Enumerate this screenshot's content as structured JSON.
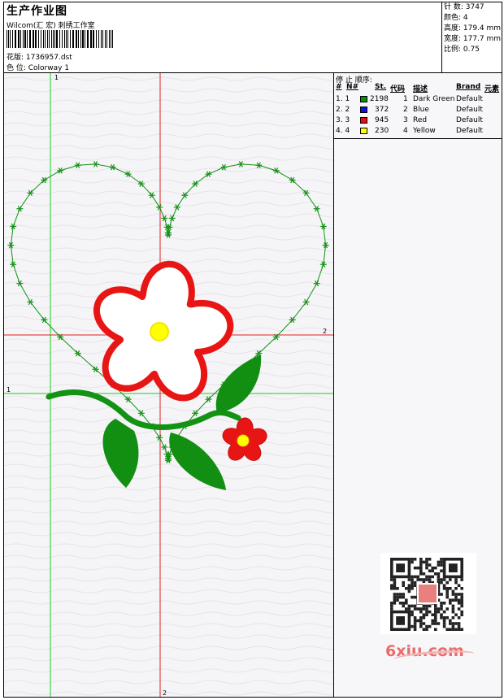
{
  "header": {
    "title": "生产作业图",
    "company": "Wilcom(汇 宏) 刺绣工作室",
    "design_label": "花版: 1736957.dst",
    "colorway_label": "色 位: Colorway 1"
  },
  "stats": {
    "stitches": "针 数: 3747",
    "colors": "颜色: 4",
    "height": "高度: 179.4 mm",
    "width": "宽度: 177.7 mm",
    "scale": "比例: 0.75"
  },
  "stop_sequence": {
    "title": "停 止 顺序:",
    "headers": [
      "#",
      "N#",
      "St.",
      "代码",
      "描述",
      "Brand",
      "元素"
    ],
    "rows": [
      {
        "idx": "1. 1",
        "color": "#0a8f0a",
        "stitches": "2198",
        "code": "1",
        "desc": "Dark Green",
        "brand": "Default"
      },
      {
        "idx": "2. 2",
        "color": "#1010e0",
        "stitches": "372",
        "code": "2",
        "desc": "Blue",
        "brand": "Default"
      },
      {
        "idx": "3. 3",
        "color": "#e01010",
        "stitches": "945",
        "code": "3",
        "desc": "Red",
        "brand": "Default"
      },
      {
        "idx": "4. 4",
        "color": "#ffff00",
        "stitches": "230",
        "code": "4",
        "desc": "Yellow",
        "brand": "Default"
      }
    ]
  },
  "guides": {
    "v_green": "1",
    "h_green": "1",
    "v_red": "2",
    "h_red": "2"
  },
  "watermark": {
    "site": "6xiu.com"
  },
  "colors": {
    "green": "#139213",
    "red": "#e81515",
    "yellow": "#ffff00",
    "guide_green": "#19d219",
    "guide_red": "#e02020"
  }
}
